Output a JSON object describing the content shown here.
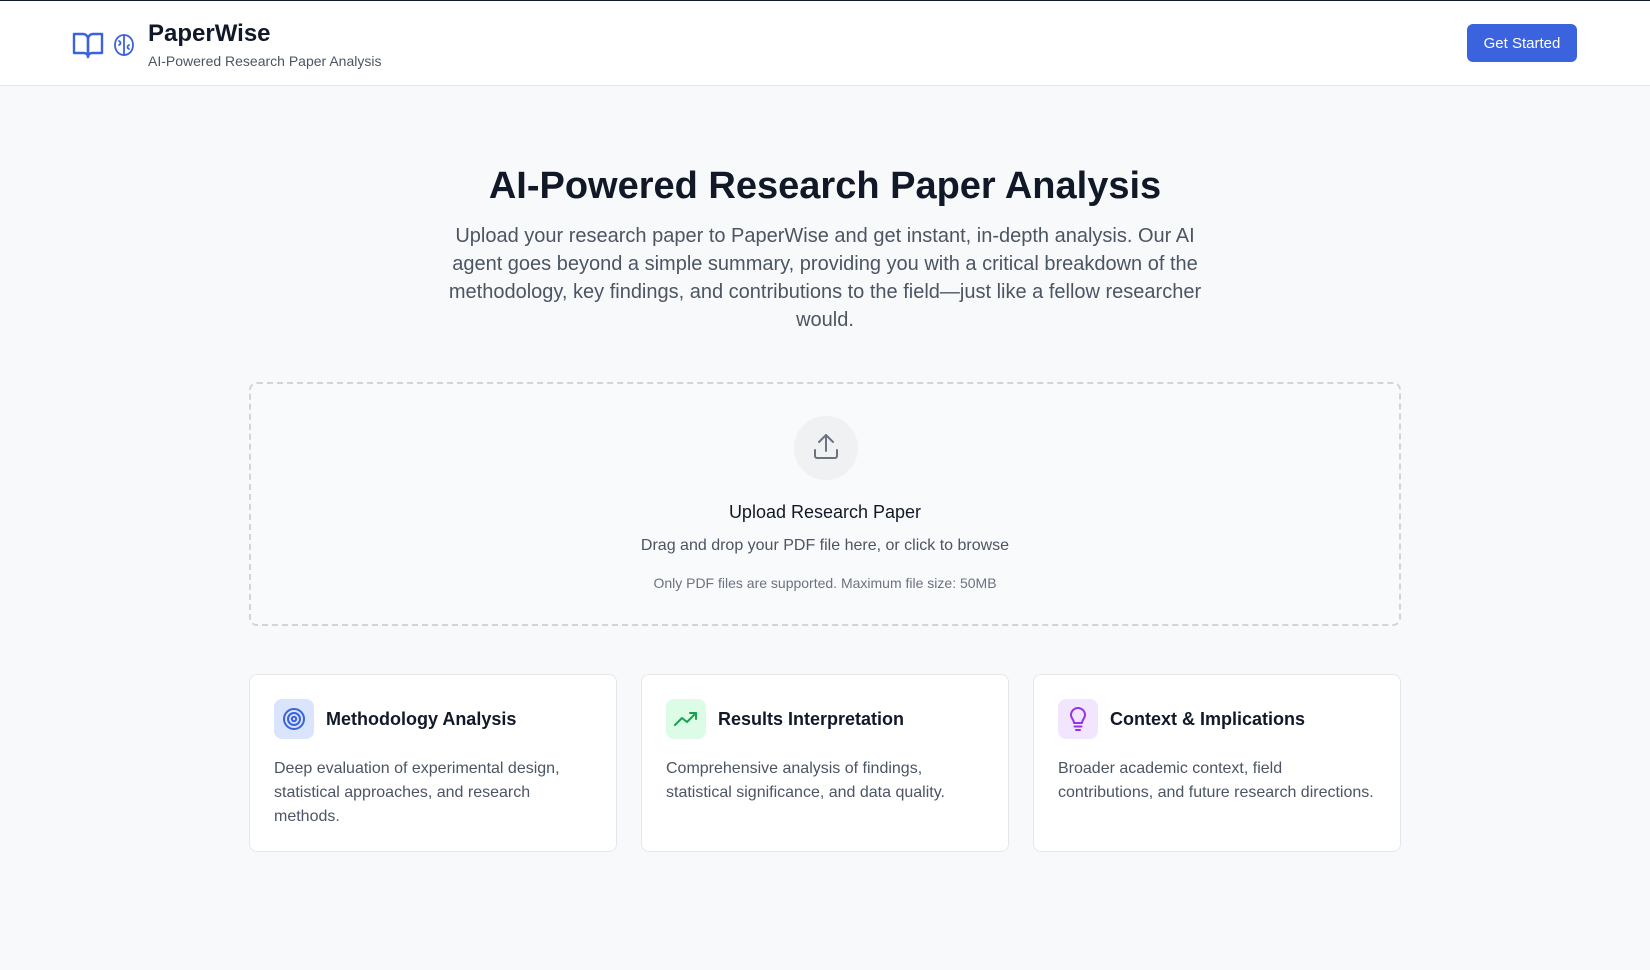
{
  "header": {
    "brand_name": "PaperWise",
    "tagline": "AI-Powered Research Paper Analysis",
    "cta_label": "Get Started",
    "icons": [
      "book-open-icon",
      "brain-icon"
    ]
  },
  "hero": {
    "title": "AI-Powered Research Paper Analysis",
    "description": "Upload your research paper to PaperWise and get instant, in-depth analysis. Our AI agent goes beyond a simple summary, providing you with a critical breakdown of the methodology, key findings, and contributions to the field—just like a fellow researcher would."
  },
  "upload": {
    "icon": "upload-icon",
    "title": "Upload Research Paper",
    "subtitle": "Drag and drop your PDF file here, or click to browse",
    "note": "Only PDF files are supported. Maximum file size: 50MB"
  },
  "features": [
    {
      "icon": "target-icon",
      "title": "Methodology Analysis",
      "description": "Deep evaluation of experimental design, statistical approaches, and research methods."
    },
    {
      "icon": "trending-up-icon",
      "title": "Results Interpretation",
      "description": "Comprehensive analysis of findings, statistical significance, and data quality."
    },
    {
      "icon": "lightbulb-icon",
      "title": "Context & Implications",
      "description": "Broader academic context, field contributions, and future research directions."
    }
  ],
  "colors": {
    "primary": "#3b63de",
    "background": "#f8f9fb",
    "methodology_icon_bg": "#dbe4fd",
    "results_icon_bg": "#dcfce7",
    "context_icon_bg": "#f1e6fe"
  }
}
